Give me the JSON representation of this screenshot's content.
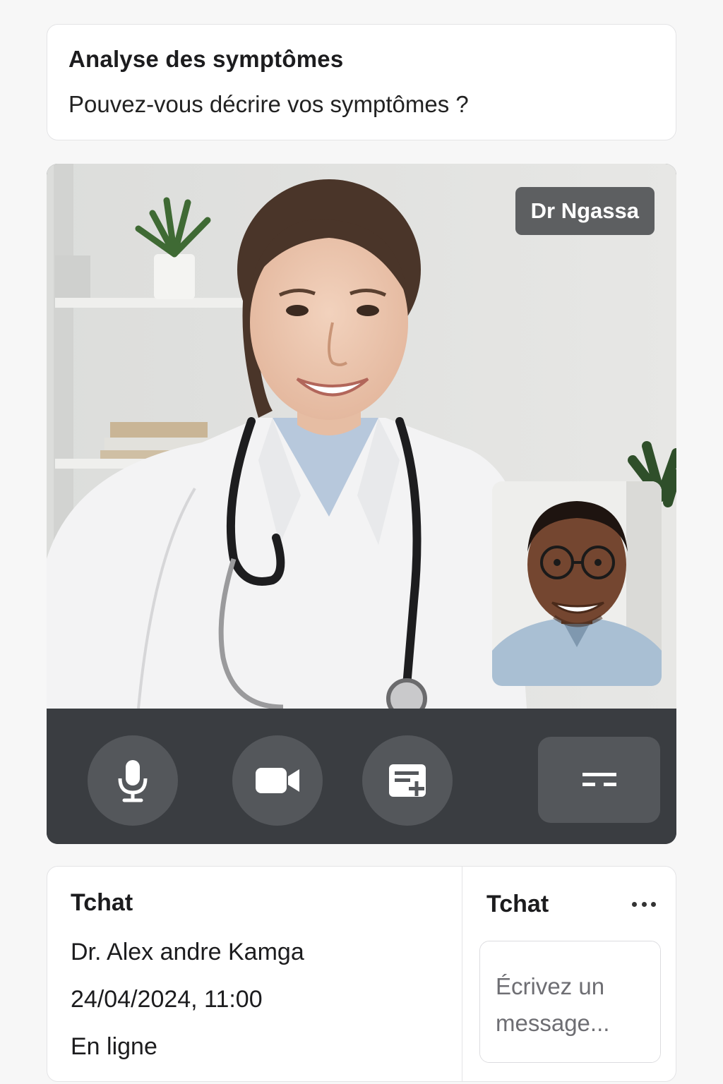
{
  "symptoms": {
    "title": "Analyse des symptômes",
    "question": "Pouvez-vous décrire vos symptômes ?"
  },
  "video": {
    "doctor_label": "Dr Ngassa",
    "controls": [
      {
        "name": "microphone",
        "icon": "microphone-icon"
      },
      {
        "name": "camera",
        "icon": "video-camera-icon"
      },
      {
        "name": "notes",
        "icon": "note-add-icon"
      },
      {
        "name": "hang-up",
        "icon": "hang-up-icon"
      }
    ]
  },
  "chat": {
    "title": "Tchat",
    "doctor_name": "Dr. Alex andre Kamga",
    "datetime": "24/04/2024, 11:00",
    "status": "En ligne",
    "side_title": "Tchat",
    "more_icon": "more-horizontal-icon",
    "input_placeholder": "Écrivez un message..."
  },
  "colors": {
    "controls_bar": "#3a3d41",
    "control_button": "#54575b",
    "label_background": "#5d5f61"
  }
}
